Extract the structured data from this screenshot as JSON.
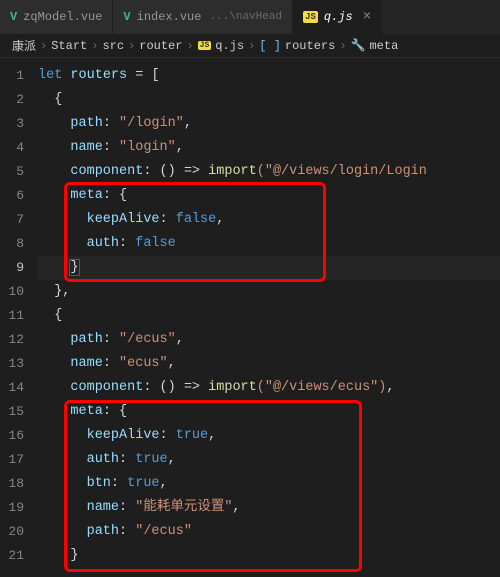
{
  "tabs": [
    {
      "icon": "V",
      "label": "zqModel.vue",
      "sub": ""
    },
    {
      "icon": "V",
      "label": "index.vue",
      "sub": "...\\navHead"
    },
    {
      "icon": "JS",
      "label": "q.js",
      "sub": ""
    }
  ],
  "activeTab": 2,
  "breadcrumbs": {
    "items": [
      "康派",
      "Start",
      "src",
      "router"
    ],
    "fileIcon": "JS",
    "file": "q.js",
    "symbol1Icon": "[ ]",
    "symbol1": "routers",
    "symbol2Icon": "🔧",
    "symbol2": "meta",
    "sep": "›"
  },
  "code": {
    "l1_let": "let",
    "l1_var": "routers",
    "l1_eq": " = [",
    "l2": "{",
    "l3_k": "path",
    "l3_v": "\"/login\"",
    "l4_k": "name",
    "l4_v": "\"login\"",
    "l5_k": "component",
    "l5_arrow": ": () => ",
    "l5_fn": "import",
    "l5_arg": "(\"@/views/login/Login",
    "l6_k": "meta",
    "l6_b": ": {",
    "l7_k": "keepAlive",
    "l7_v": "false",
    "l8_k": "auth",
    "l8_v": "false",
    "l9": "}",
    "l10": "},",
    "l11": "{",
    "l12_k": "path",
    "l12_v": "\"/ecus\"",
    "l13_k": "name",
    "l13_v": "\"ecus\"",
    "l14_k": "component",
    "l14_arrow": ": () => ",
    "l14_fn": "import",
    "l14_arg": "(\"@/views/ecus\")",
    "l15_k": "meta",
    "l15_b": ": {",
    "l16_k": "keepAlive",
    "l16_v": "true",
    "l17_k": "auth",
    "l17_v": "true",
    "l18_k": "btn",
    "l18_v": "true",
    "l19_k": "name",
    "l19_v": "\"能耗单元设置\"",
    "l20_k": "path",
    "l20_v": "\"/ecus\"",
    "l21": "}"
  },
  "lineNumbers": [
    "1",
    "2",
    "3",
    "4",
    "5",
    "6",
    "7",
    "8",
    "9",
    "10",
    "11",
    "12",
    "13",
    "14",
    "15",
    "16",
    "17",
    "18",
    "19",
    "20",
    "21"
  ],
  "currentLine": 9,
  "closeGlyph": "×"
}
